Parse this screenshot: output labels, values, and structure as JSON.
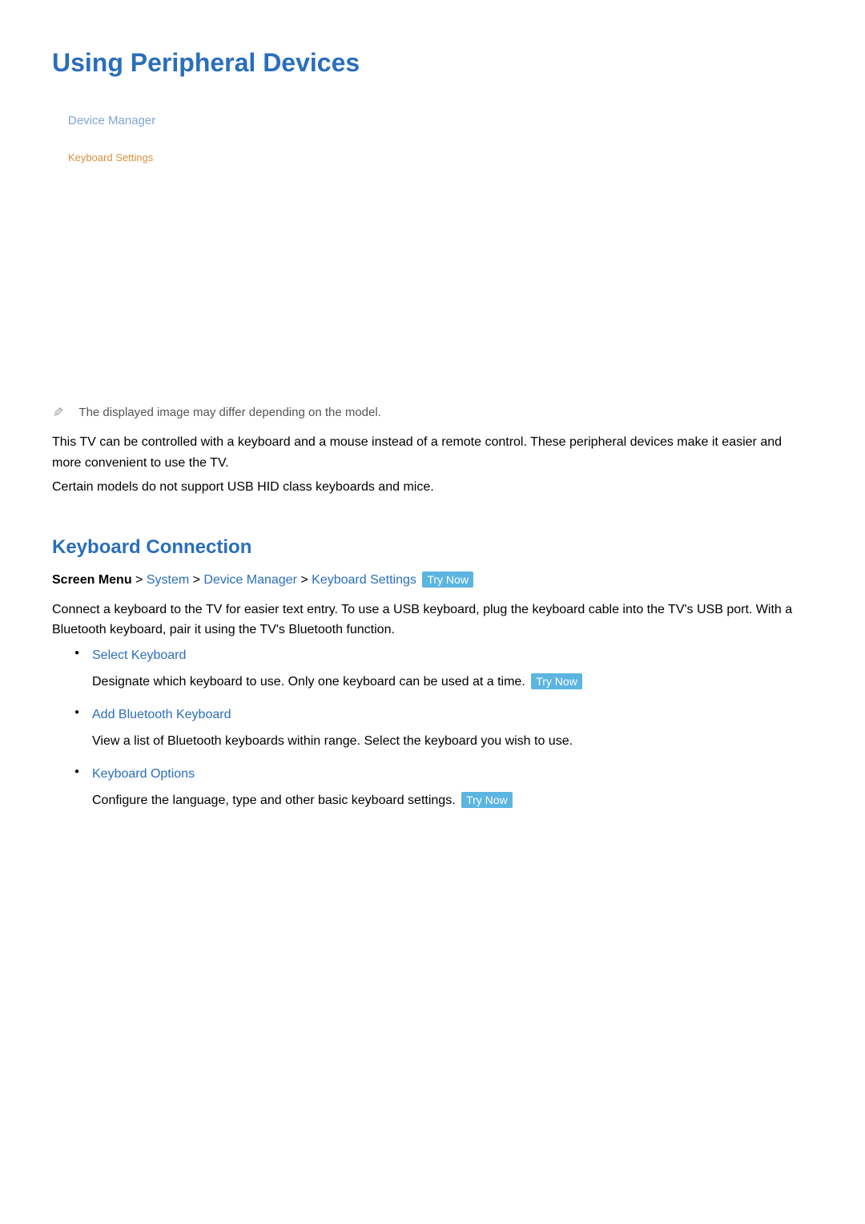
{
  "page_title": "Using Peripheral Devices",
  "device_manager_box": {
    "device_manager_label": "Device Manager",
    "keyboard_settings_label": "Keyboard Settings"
  },
  "image_note": "The displayed image may differ depending on the model.",
  "intro_para1": "This TV can be controlled with a keyboard and a mouse instead of a remote control. These peripheral devices make it easier and more convenient to use the TV.",
  "intro_para2": "Certain models do not support USB HID class keyboards and mice.",
  "section_title": "Keyboard Connection",
  "breadcrumb": {
    "prefix": "Screen Menu",
    "sep": " > ",
    "items": [
      "System",
      "Device Manager",
      "Keyboard Settings"
    ],
    "try_now": "Try Now"
  },
  "section_intro": "Connect a keyboard to the TV for easier text entry. To use a USB keyboard, plug the keyboard cable into the TV's USB port. With a Bluetooth keyboard, pair it using the TV's Bluetooth function.",
  "options": [
    {
      "title": "Select Keyboard",
      "desc": "Designate which keyboard to use. Only one keyboard can be used at a time.",
      "try_now": "Try Now"
    },
    {
      "title": "Add Bluetooth Keyboard",
      "desc": "View a list of Bluetooth keyboards within range. Select the keyboard you wish to use.",
      "try_now": null
    },
    {
      "title": "Keyboard Options",
      "desc": "Configure the language, type and other basic keyboard settings.",
      "try_now": "Try Now"
    }
  ]
}
